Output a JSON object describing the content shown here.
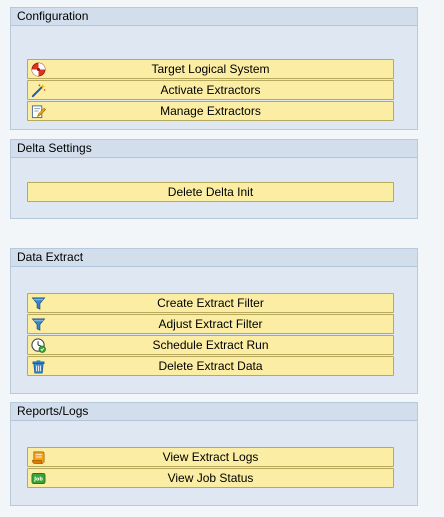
{
  "groups": {
    "configuration": {
      "title": "Configuration",
      "buttons": [
        {
          "label": "Target Logical System",
          "icon": "target-icon"
        },
        {
          "label": "Activate Extractors",
          "icon": "magic-wand-icon"
        },
        {
          "label": "Manage Extractors",
          "icon": "edit-document-icon"
        }
      ]
    },
    "delta": {
      "title": "Delta Settings",
      "buttons": [
        {
          "label": "Delete Delta Init"
        }
      ]
    },
    "extract": {
      "title": "Data Extract",
      "buttons": [
        {
          "label": "Create Extract Filter",
          "icon": "filter-icon"
        },
        {
          "label": "Adjust Extract Filter",
          "icon": "filter-icon"
        },
        {
          "label": "Schedule Extract Run",
          "icon": "schedule-icon"
        },
        {
          "label": "Delete Extract Data",
          "icon": "trash-icon"
        }
      ]
    },
    "reports": {
      "title": "Reports/Logs",
      "buttons": [
        {
          "label": "View Extract Logs",
          "icon": "log-icon"
        },
        {
          "label": "View Job Status",
          "icon": "job-icon"
        }
      ]
    }
  },
  "icons": {
    "job_icon_text": "Job"
  },
  "colors": {
    "button_bg": "#fbeda3",
    "button_border": "#b8aa5c",
    "group_bg": "#dfe8f2",
    "group_header_bg": "#d2deec"
  }
}
